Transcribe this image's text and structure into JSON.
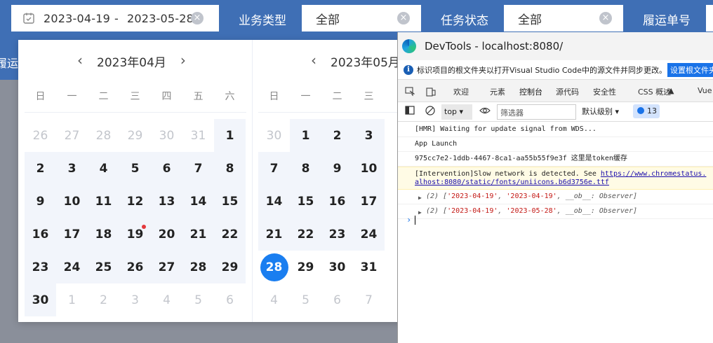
{
  "filter_bar": {
    "date_range": {
      "start": "2023-04-19",
      "separator": "-",
      "end": "2023-05-28"
    },
    "business_type": {
      "label": "业务类型",
      "value": "全部"
    },
    "task_status": {
      "label": "任务状态",
      "value": "全部"
    },
    "waybill_no": {
      "label": "履运单号"
    }
  },
  "left_fragment": "履运",
  "weekdays": [
    "日",
    "一",
    "二",
    "三",
    "四",
    "五",
    "六"
  ],
  "calendars": [
    {
      "title": "2023年04月",
      "days": [
        {
          "d": "26",
          "off": true
        },
        {
          "d": "27",
          "off": true
        },
        {
          "d": "28",
          "off": true
        },
        {
          "d": "29",
          "off": true
        },
        {
          "d": "30",
          "off": true
        },
        {
          "d": "31",
          "off": true
        },
        {
          "d": "1",
          "off": false
        },
        {
          "d": "2",
          "off": false
        },
        {
          "d": "3",
          "off": false
        },
        {
          "d": "4",
          "off": false
        },
        {
          "d": "5",
          "off": false
        },
        {
          "d": "6",
          "off": false
        },
        {
          "d": "7",
          "off": false
        },
        {
          "d": "8",
          "off": false
        },
        {
          "d": "9",
          "off": false
        },
        {
          "d": "10",
          "off": false
        },
        {
          "d": "11",
          "off": false
        },
        {
          "d": "12",
          "off": false
        },
        {
          "d": "13",
          "off": false
        },
        {
          "d": "14",
          "off": false
        },
        {
          "d": "15",
          "off": false
        },
        {
          "d": "16",
          "off": false
        },
        {
          "d": "17",
          "off": false
        },
        {
          "d": "18",
          "off": false
        },
        {
          "d": "19",
          "off": false,
          "dot": true
        },
        {
          "d": "20",
          "off": false
        },
        {
          "d": "21",
          "off": false
        },
        {
          "d": "22",
          "off": false
        },
        {
          "d": "23",
          "off": false
        },
        {
          "d": "24",
          "off": false
        },
        {
          "d": "25",
          "off": false
        },
        {
          "d": "26",
          "off": false
        },
        {
          "d": "27",
          "off": false
        },
        {
          "d": "28",
          "off": false
        },
        {
          "d": "29",
          "off": false
        },
        {
          "d": "30",
          "off": false
        },
        {
          "d": "1",
          "off": true
        },
        {
          "d": "2",
          "off": true
        },
        {
          "d": "3",
          "off": true
        },
        {
          "d": "4",
          "off": true
        },
        {
          "d": "5",
          "off": true
        },
        {
          "d": "6",
          "off": true
        }
      ]
    },
    {
      "title": "2023年05月",
      "days": [
        {
          "d": "30",
          "off": true
        },
        {
          "d": "1",
          "off": false
        },
        {
          "d": "2",
          "off": false
        },
        {
          "d": "3",
          "off": false
        },
        {
          "d": "7",
          "off": false
        },
        {
          "d": "8",
          "off": false
        },
        {
          "d": "9",
          "off": false
        },
        {
          "d": "10",
          "off": false
        },
        {
          "d": "14",
          "off": false
        },
        {
          "d": "15",
          "off": false
        },
        {
          "d": "16",
          "off": false
        },
        {
          "d": "17",
          "off": false
        },
        {
          "d": "21",
          "off": false
        },
        {
          "d": "22",
          "off": false
        },
        {
          "d": "23",
          "off": false
        },
        {
          "d": "24",
          "off": false
        },
        {
          "d": "28",
          "off": false,
          "selected": true
        },
        {
          "d": "29",
          "off": false
        },
        {
          "d": "30",
          "off": false
        },
        {
          "d": "31",
          "off": false
        },
        {
          "d": "4",
          "off": true
        },
        {
          "d": "5",
          "off": true
        },
        {
          "d": "6",
          "off": true
        },
        {
          "d": "7",
          "off": true
        }
      ]
    }
  ],
  "devtools": {
    "title": "DevTools - localhost:8080/",
    "info_message": "标识项目的根文件夹以打开Visual Studio Code中的源文件并同步更改。",
    "info_button": "设置根文件夹",
    "tabs": [
      "欢迎",
      "元素",
      "控制台",
      "源代码",
      "安全性",
      "CSS 概述",
      "Vue"
    ],
    "active_tab": "控制台",
    "context": "top",
    "filter_placeholder": "筛选器",
    "level": "默认级别",
    "issue_count": "13",
    "logs": [
      "[HMR] Waiting for update signal from WDS...",
      "App Launch",
      "975cc7e2-1ddb-4467-8ca1-aa55b55f9e3f 这里是token缓存"
    ],
    "warning": {
      "text": "[Intervention]Slow network is detected. See ",
      "link1": "https://www.chromestatus.",
      "link2": "alhost:8080/static/fonts/uniicons.b6d3756e.ttf"
    },
    "arrays": [
      {
        "prefix": "(2) [",
        "a": "'2023-04-19'",
        "b": "'2023-04-19'",
        "suffix": ", __ob__: Observer]"
      },
      {
        "prefix": "(2) [",
        "a": "'2023-04-19'",
        "b": "'2023-05-28'",
        "suffix": ", __ob__: Observer]"
      }
    ],
    "colors": {
      "accent": "#1a73e8",
      "primary_blue": "#3f6fb5",
      "selected_day": "#1a7ef0"
    }
  }
}
